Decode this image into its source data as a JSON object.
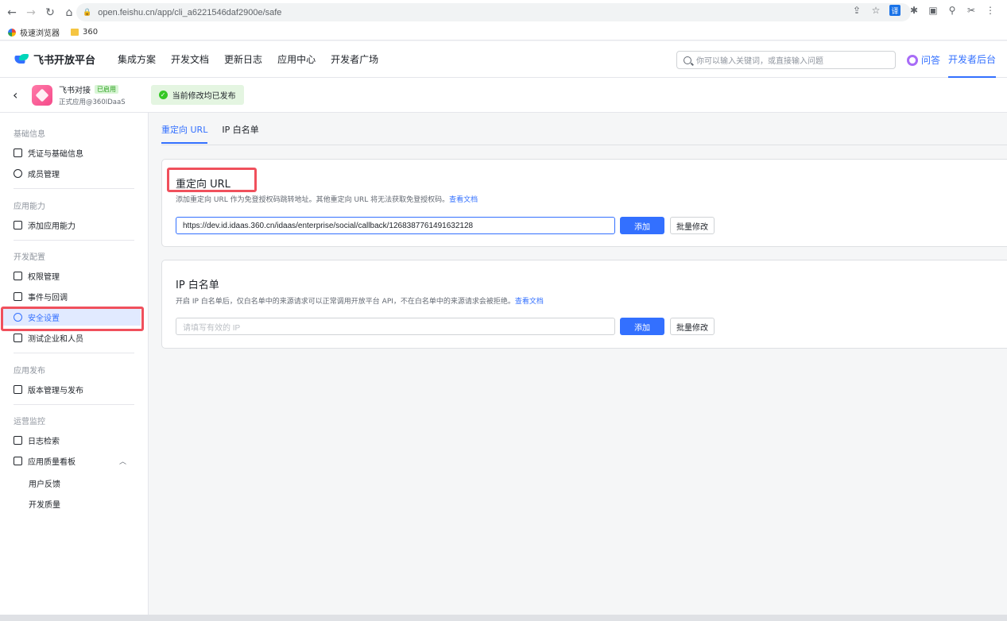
{
  "browser": {
    "url": "open.feishu.cn/app/cli_a6221546daf2900e/safe",
    "bookmarks": [
      "极速浏览器",
      "360"
    ]
  },
  "topnav": {
    "logo_text": "飞书开放平台",
    "links": [
      "集成方案",
      "开发文档",
      "更新日志",
      "应用中心",
      "开发者广场"
    ],
    "search_placeholder": "你可以输入关键词，或直接输入问题",
    "ask_label": "问答",
    "dev_backend_label": "开发者后台"
  },
  "app": {
    "name": "飞书对接",
    "status_tag": "已启用",
    "subtitle": "正式应用@360IDaaS",
    "publish_note": "当前修改均已发布"
  },
  "sidebar": {
    "groups": [
      {
        "title": "基础信息",
        "items": [
          "凭证与基础信息",
          "成员管理"
        ]
      },
      {
        "title": "应用能力",
        "items": [
          "添加应用能力"
        ]
      },
      {
        "title": "开发配置",
        "items": [
          "权限管理",
          "事件与回调",
          "安全设置",
          "测试企业和人员"
        ]
      },
      {
        "title": "应用发布",
        "items": [
          "版本管理与发布"
        ]
      },
      {
        "title": "运营监控",
        "items": [
          "日志检索",
          "应用质量看板"
        ]
      }
    ],
    "sub_items": [
      "用户反馈",
      "开发质量"
    ],
    "active_item": "安全设置"
  },
  "tabs": [
    "重定向 URL",
    "IP 白名单"
  ],
  "redirect_card": {
    "title": "重定向 URL",
    "desc": "添加重定向 URL 作为免登授权码跳转地址。其他重定向 URL 将无法获取免登授权码。",
    "doc_link": "查看文档",
    "input_value": "https://dev.id.idaas.360.cn/idaas/enterprise/social/callback/1268387761491632128",
    "add_label": "添加",
    "batch_label": "批量修改"
  },
  "ip_card": {
    "title": "IP 白名单",
    "desc": "开启 IP 白名单后，仅白名单中的来源请求可以正常调用开放平台 API，不在白名单中的来源请求会被拒绝。",
    "doc_link": "查看文档",
    "input_placeholder": "请填写有效的 IP",
    "add_label": "添加",
    "batch_label": "批量修改"
  }
}
